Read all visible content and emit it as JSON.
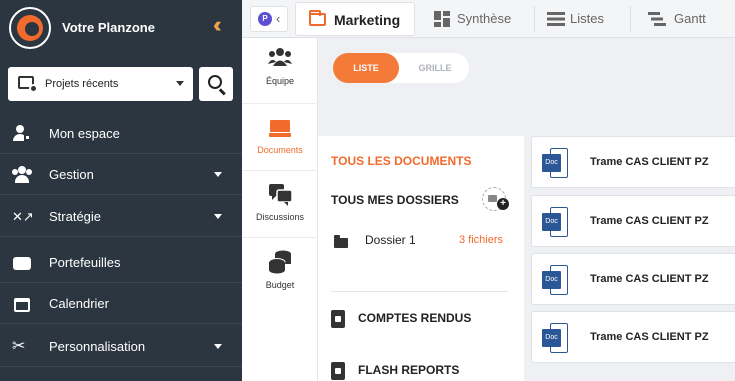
{
  "sidebar": {
    "brand": "Votre Planzone",
    "projects_label": "Projets récents",
    "items": [
      {
        "label": "Mon espace",
        "icon": "user-lock-icon",
        "has_caret": false
      },
      {
        "label": "Gestion",
        "icon": "users-cog-icon",
        "has_caret": true
      },
      {
        "label": "Stratégie",
        "icon": "strategy-icon",
        "has_caret": true
      },
      {
        "label": "Portefeuilles",
        "icon": "wallet-icon",
        "has_caret": false
      },
      {
        "label": "Calendrier",
        "icon": "calendar-icon",
        "has_caret": false
      },
      {
        "label": "Personnalisation",
        "icon": "tools-icon",
        "has_caret": true
      }
    ]
  },
  "topbar": {
    "project_badge": "P",
    "tabs": [
      {
        "label": "Marketing",
        "icon": "folder-open-icon"
      },
      {
        "label": "Synthèse",
        "icon": "dashboard-icon"
      },
      {
        "label": "Listes",
        "icon": "list-icon"
      },
      {
        "label": "Gantt",
        "icon": "gantt-icon"
      }
    ]
  },
  "subnav": {
    "items": [
      {
        "label": "Équipe",
        "icon": "team-icon",
        "active": false
      },
      {
        "label": "Documents",
        "icon": "documents-icon",
        "active": true
      },
      {
        "label": "Discussions",
        "icon": "comments-icon",
        "active": false
      },
      {
        "label": "Budget",
        "icon": "coins-icon",
        "active": false
      }
    ]
  },
  "main": {
    "view_toggle": {
      "active": "LISTE",
      "inactive": "GRILLE"
    },
    "all_documents": "TOUS LES DOCUMENTS",
    "my_folders": "TOUS MES DOSSIERS",
    "folder": {
      "name": "Dossier 1",
      "count": "3 fichiers"
    },
    "sections": [
      "COMPTES RENDUS",
      "FLASH REPORTS"
    ],
    "doc_tag": "Doc",
    "documents": [
      {
        "name": "Trame CAS CLIENT PZ"
      },
      {
        "name": "Trame CAS CLIENT PZ"
      },
      {
        "name": "Trame CAS CLIENT PZ"
      },
      {
        "name": "Trame CAS CLIENT PZ"
      }
    ]
  },
  "colors": {
    "accent": "#f26a2e",
    "sidebar": "#2b3640",
    "word_blue": "#2b5797"
  }
}
